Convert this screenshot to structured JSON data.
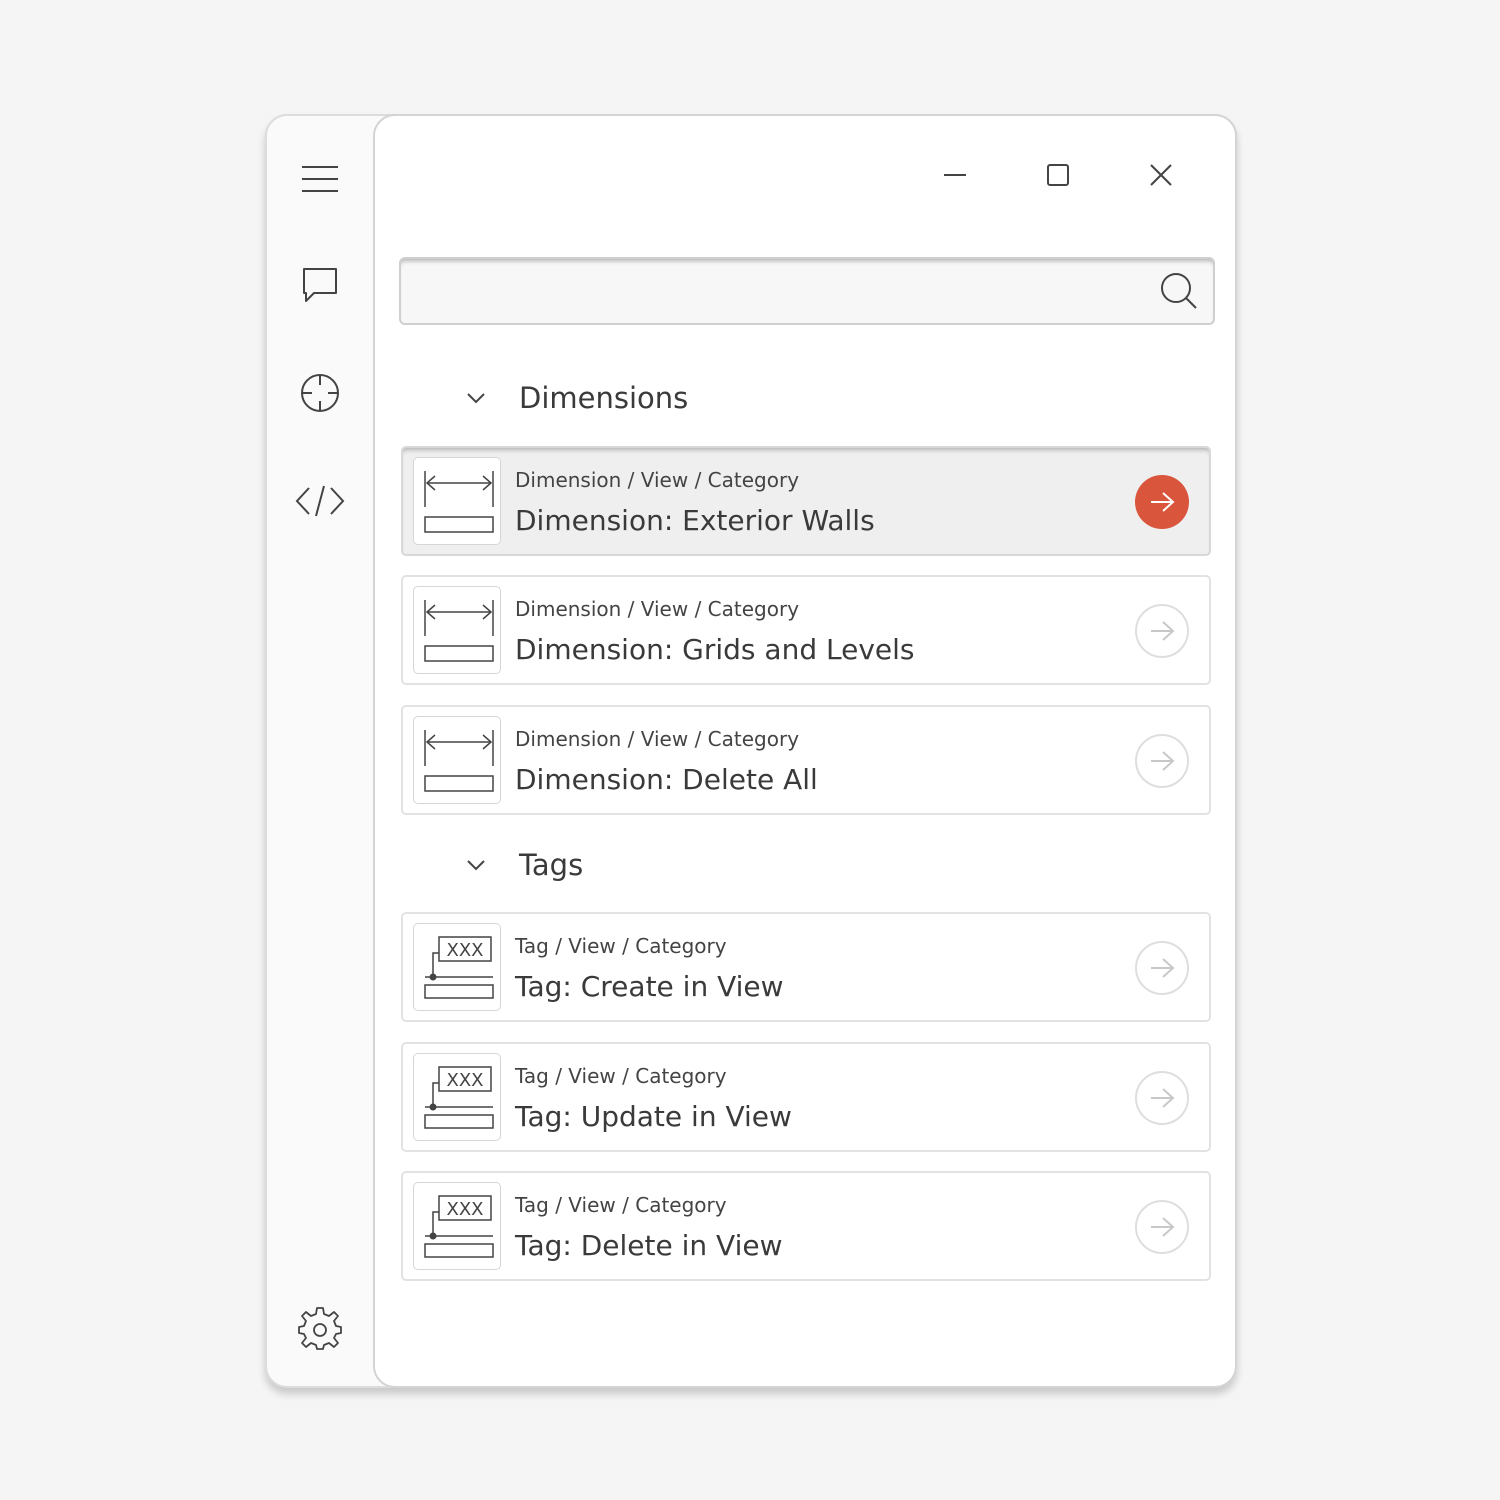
{
  "colors": {
    "accent": "#d9553c",
    "background": "#f5f5f5",
    "panel": "#ffffff"
  },
  "sidebar": {
    "items": [
      {
        "icon": "hamburger-menu-icon"
      },
      {
        "icon": "chat-bubble-icon"
      },
      {
        "icon": "crosshair-target-icon"
      },
      {
        "icon": "code-brackets-icon"
      }
    ],
    "footer_icon": "gear-icon"
  },
  "window_controls": [
    "minimize-icon",
    "maximize-icon",
    "close-icon"
  ],
  "search": {
    "value": "",
    "placeholder": "",
    "icon": "search-icon"
  },
  "groups": [
    {
      "title": "Dimensions",
      "expanded": true,
      "items": [
        {
          "category": "Dimension / View / Category",
          "title": "Dimension: Exterior Walls",
          "icon": "dimension-icon",
          "active": true
        },
        {
          "category": "Dimension / View / Category",
          "title": "Dimension: Grids and Levels",
          "icon": "dimension-icon",
          "active": false
        },
        {
          "category": "Dimension / View / Category",
          "title": "Dimension: Delete All",
          "icon": "dimension-icon",
          "active": false
        }
      ]
    },
    {
      "title": "Tags",
      "expanded": true,
      "items": [
        {
          "category": "Tag / View / Category",
          "title": "Tag: Create in View",
          "icon": "tag-icon",
          "tag_text": "XXX",
          "active": false
        },
        {
          "category": "Tag / View / Category",
          "title": "Tag: Update in View",
          "icon": "tag-icon",
          "tag_text": "XXX",
          "active": false
        },
        {
          "category": "Tag / View / Category",
          "title": "Tag: Delete in View",
          "icon": "tag-icon",
          "tag_text": "XXX",
          "active": false
        }
      ]
    }
  ]
}
